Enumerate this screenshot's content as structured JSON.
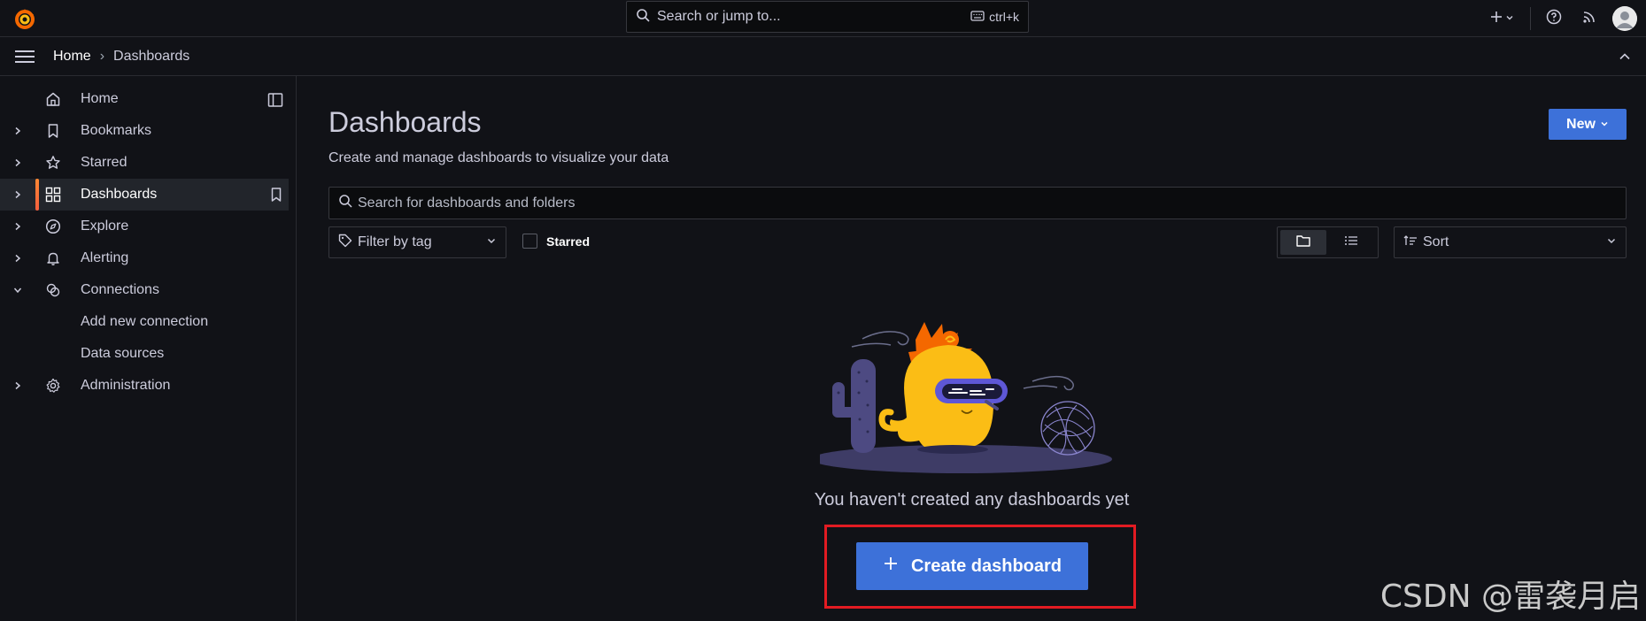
{
  "topbar": {
    "search_placeholder": "Search or jump to...",
    "shortcut": "ctrl+k"
  },
  "breadcrumb": {
    "home": "Home",
    "separator": "›",
    "current": "Dashboards"
  },
  "sidebar": {
    "items": [
      {
        "label": "Home",
        "icon": "home-icon"
      },
      {
        "label": "Bookmarks",
        "icon": "bookmark-icon"
      },
      {
        "label": "Starred",
        "icon": "star-icon"
      },
      {
        "label": "Dashboards",
        "icon": "apps-icon"
      },
      {
        "label": "Explore",
        "icon": "compass-icon"
      },
      {
        "label": "Alerting",
        "icon": "bell-icon"
      },
      {
        "label": "Connections",
        "icon": "link-icon"
      },
      {
        "label": "Add new connection"
      },
      {
        "label": "Data sources"
      },
      {
        "label": "Administration",
        "icon": "cog-icon"
      }
    ]
  },
  "main": {
    "title": "Dashboards",
    "subtitle": "Create and manage dashboards to visualize your data",
    "new_label": "New",
    "search_placeholder": "Search for dashboards and folders",
    "filter_tag": "Filter by tag",
    "starred_label": "Starred",
    "sort_label": "Sort",
    "empty_message": "You haven't created any dashboards yet",
    "create_label": "Create dashboard"
  },
  "watermark": "CSDN @雷袭月启",
  "colors": {
    "accent": "#3d71d9",
    "active_bar": "#f55f3e",
    "highlight": "#e21b22"
  }
}
